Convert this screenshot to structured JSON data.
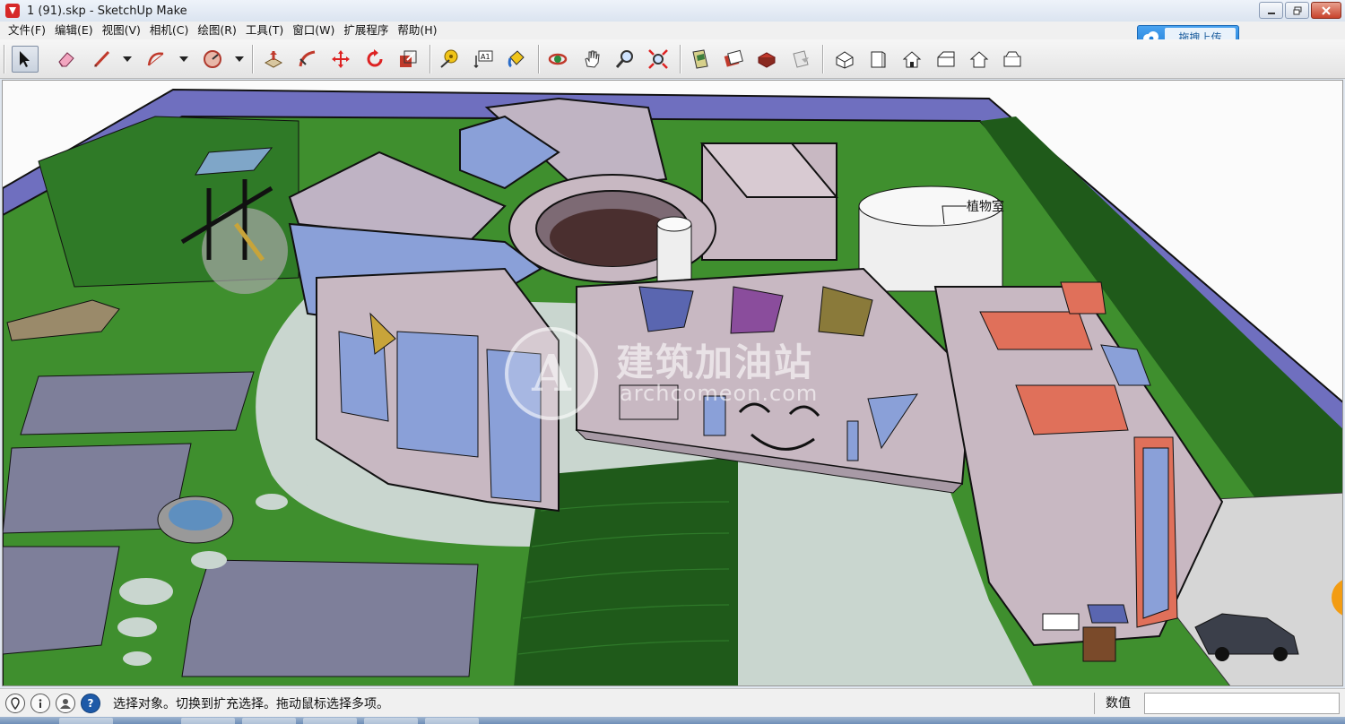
{
  "window": {
    "title": "1 (91).skp - SketchUp Make",
    "controls": [
      "minimize",
      "restore",
      "close"
    ]
  },
  "menu": {
    "items": [
      "文件(F)",
      "编辑(E)",
      "视图(V)",
      "相机(C)",
      "绘图(R)",
      "工具(T)",
      "窗口(W)",
      "扩展程序",
      "帮助(H)"
    ]
  },
  "upload_button": {
    "label": "拖拽上传",
    "icon": "cloud-icon"
  },
  "toolbar": {
    "tools": [
      "select-icon",
      "eraser-icon",
      "line-icon",
      "arc-icon",
      "shape-icon",
      "push-pull-icon",
      "follow-me-icon",
      "move-icon",
      "rotate-icon",
      "scale-icon",
      "tape-measure-icon",
      "text-icon",
      "paint-bucket-icon",
      "orbit-icon",
      "pan-icon",
      "zoom-icon",
      "zoom-extents-icon",
      "warehouse-icon",
      "share-model-icon",
      "extension-warehouse-icon",
      "layout-icon",
      "iso-view-icon",
      "top-view-icon",
      "front-view-icon",
      "right-view-icon",
      "back-view-icon",
      "left-view-icon"
    ],
    "active_tool": "select-icon",
    "text_tool_glyph": "A1"
  },
  "viewport": {
    "watermark_logo": "A",
    "watermark_title": "建筑加油站",
    "watermark_subtitle": "archcomeon.com",
    "annotation_label": "植物室",
    "colors": {
      "lawn": "#3f8f2e",
      "road": "#6f6fbf",
      "building_wall": "#c8b8c2",
      "window_blue": "#8aa0d8",
      "roof_red": "#e0705a",
      "plaza": "#c9d6cf",
      "dark_lawn": "#1f5a1a"
    }
  },
  "statusbar": {
    "icons": [
      "location-icon",
      "info-icon",
      "user-icon",
      "help-icon"
    ],
    "message": "选择对象。切换到扩充选择。拖动鼠标选择多项。",
    "measure_label": "数值",
    "measure_value": ""
  }
}
